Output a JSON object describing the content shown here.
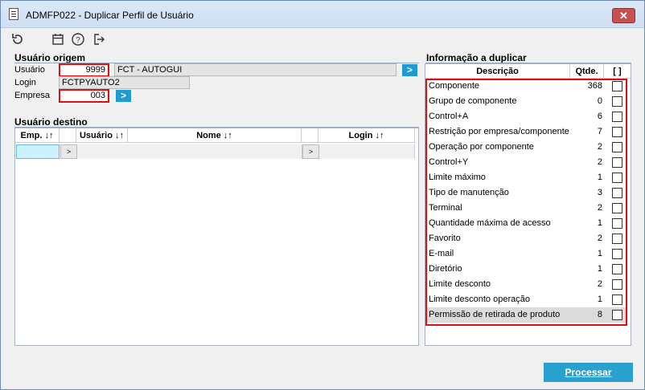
{
  "window": {
    "title": "ADMFP022 - Duplicar Perfil de Usuário",
    "close_glyph": "✕"
  },
  "toolbar": {
    "icons": [
      "refresh-icon",
      "calendar-icon",
      "help-icon",
      "exit-icon"
    ]
  },
  "origem": {
    "title": "Usuário origem",
    "usuario_label": "Usuário",
    "usuario_value": "9999",
    "usuario_name": "FCT - AUTOGUI",
    "login_label": "Login",
    "login_value": "FCTPYAUTO2",
    "empresa_label": "Empresa",
    "empresa_value": "003",
    "go_glyph": ">"
  },
  "destino": {
    "title": "Usuário destino",
    "columns": {
      "emp": "Emp. ↓↑",
      "usuario": "Usuário ↓↑",
      "nome": "Nome ↓↑",
      "login": "Login ↓↑"
    },
    "row_btn": ">"
  },
  "info": {
    "title": "Informação a duplicar",
    "columns": {
      "descricao": "Descrição",
      "qtde": "Qtde.",
      "check": "[ ]"
    },
    "rows": [
      {
        "descricao": "Componente",
        "qtde": "368"
      },
      {
        "descricao": "Grupo de componente",
        "qtde": "0"
      },
      {
        "descricao": "Control+A",
        "qtde": "6"
      },
      {
        "descricao": "Restrição por empresa/componente",
        "qtde": "7"
      },
      {
        "descricao": "Operação por componente",
        "qtde": "2"
      },
      {
        "descricao": "Control+Y",
        "qtde": "2"
      },
      {
        "descricao": "Limite máximo",
        "qtde": "1"
      },
      {
        "descricao": "Tipo de manutenção",
        "qtde": "3"
      },
      {
        "descricao": "Terminal",
        "qtde": "2"
      },
      {
        "descricao": "Quantidade máxima de acesso",
        "qtde": "1"
      },
      {
        "descricao": "Favorito",
        "qtde": "2"
      },
      {
        "descricao": "E-mail",
        "qtde": "1"
      },
      {
        "descricao": "Diretório",
        "qtde": "1"
      },
      {
        "descricao": "Limite desconto",
        "qtde": "2"
      },
      {
        "descricao": "Limite desconto operação",
        "qtde": "1"
      },
      {
        "descricao": "Permissão de retirada de produto",
        "qtde": "8"
      }
    ]
  },
  "actions": {
    "processar": "Processar"
  }
}
